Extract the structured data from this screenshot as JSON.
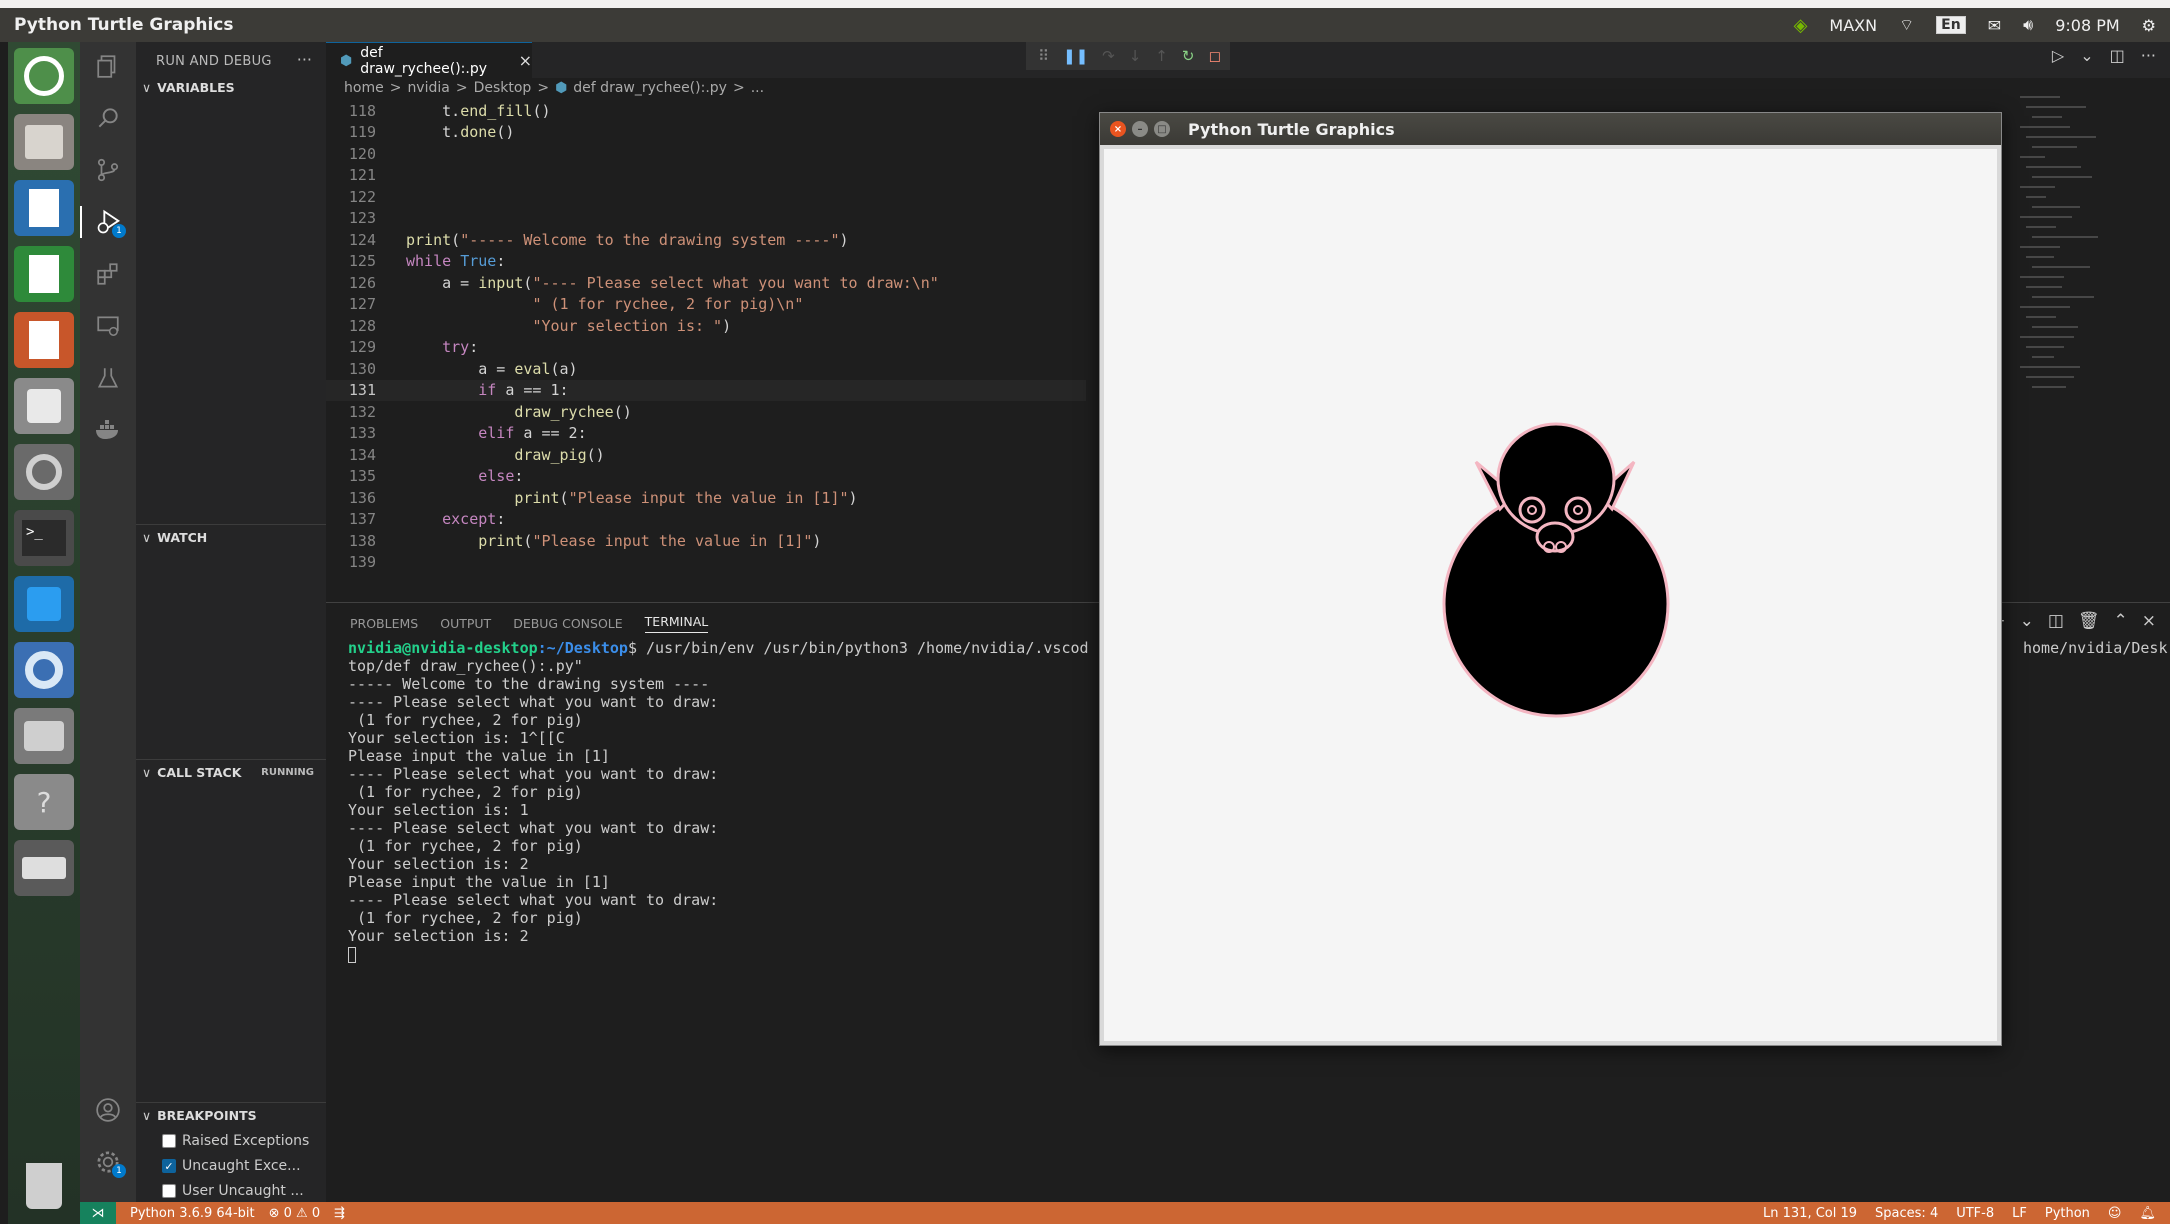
{
  "top_panel": {
    "title": "Python Turtle Graphics",
    "mode": "MAXN",
    "lang": "En",
    "time": "9:08 PM"
  },
  "sidebar": {
    "title": "RUN AND DEBUG",
    "more": "···",
    "variables": "VARIABLES",
    "watch": "WATCH",
    "call_stack": "CALL STACK",
    "call_stack_status": "RUNNING",
    "breakpoints": "BREAKPOINTS",
    "bp_items": [
      {
        "label": "Raised Exceptions",
        "checked": false
      },
      {
        "label": "Uncaught Exce...",
        "checked": true
      },
      {
        "label": "User Uncaught ...",
        "checked": false
      }
    ]
  },
  "editor": {
    "tab_label": "def draw_rychee():.py",
    "breadcrumb": [
      "home",
      ">",
      "nvidia",
      ">",
      "Desktop",
      ">",
      "def draw_rychee():.py",
      ">",
      "..."
    ],
    "active_line": "131",
    "lines": [
      {
        "n": "118",
        "code": "    t.end_fill()"
      },
      {
        "n": "119",
        "code": "    t.done()"
      },
      {
        "n": "120",
        "code": ""
      },
      {
        "n": "121",
        "code": ""
      },
      {
        "n": "122",
        "code": ""
      },
      {
        "n": "123",
        "code": ""
      },
      {
        "n": "124",
        "code": "print(\"----- Welcome to the drawing system ----\")"
      },
      {
        "n": "125",
        "code": "while True:"
      },
      {
        "n": "126",
        "code": "    a = input(\"---- Please select what you want to draw:\\n\""
      },
      {
        "n": "127",
        "code": "              \" (1 for rychee, 2 for pig)\\n\""
      },
      {
        "n": "128",
        "code": "              \"Your selection is: \")"
      },
      {
        "n": "129",
        "code": "    try:"
      },
      {
        "n": "130",
        "code": "        a = eval(a)"
      },
      {
        "n": "131",
        "code": "        if a == 1:"
      },
      {
        "n": "132",
        "code": "            draw_rychee()"
      },
      {
        "n": "133",
        "code": "        elif a == 2:"
      },
      {
        "n": "134",
        "code": "            draw_pig()"
      },
      {
        "n": "135",
        "code": "        else:"
      },
      {
        "n": "136",
        "code": "            print(\"Please input the value in [1]\")"
      },
      {
        "n": "137",
        "code": "    except:"
      },
      {
        "n": "138",
        "code": "        print(\"Please input the value in [1]\")"
      },
      {
        "n": "139",
        "code": ""
      }
    ]
  },
  "panel": {
    "tabs": [
      "PROBLEMS",
      "OUTPUT",
      "DEBUG CONSOLE",
      "TERMINAL"
    ],
    "active_tab": "TERMINAL",
    "prompt_user": "nvidia@nvidia-desktop",
    "prompt_path": ":~/Desktop",
    "prompt_dollar": "$ ",
    "command": "/usr/bin/env /usr/bin/python3 /home/nvidia/.vscod",
    "command_tail": "home/nvidia/Desk",
    "output": [
      "top/def draw_rychee():.py\"",
      "----- Welcome to the drawing system ----",
      "---- Please select what you want to draw:",
      " (1 for rychee, 2 for pig)",
      "Your selection is: 1^[[C",
      "Please input the value in [1]",
      "---- Please select what you want to draw:",
      " (1 for rychee, 2 for pig)",
      "Your selection is: 1",
      "---- Please select what you want to draw:",
      " (1 for rychee, 2 for pig)",
      "Your selection is: 2",
      "Please input the value in [1]",
      "---- Please select what you want to draw:",
      " (1 for rychee, 2 for pig)",
      "Your selection is: 2"
    ]
  },
  "statusbar": {
    "python": "Python 3.6.9 64-bit",
    "problems": "⊗ 0 ⚠ 0",
    "position": "Ln 131, Col 19",
    "spaces": "Spaces: 4",
    "encoding": "UTF-8",
    "eol": "LF",
    "language": "Python"
  },
  "turtle_window": {
    "title": "Python Turtle Graphics"
  },
  "colors": {
    "statusbar": "#cc6633",
    "pig_outline": "#f4b6c2",
    "pig_fill": "#000000"
  }
}
